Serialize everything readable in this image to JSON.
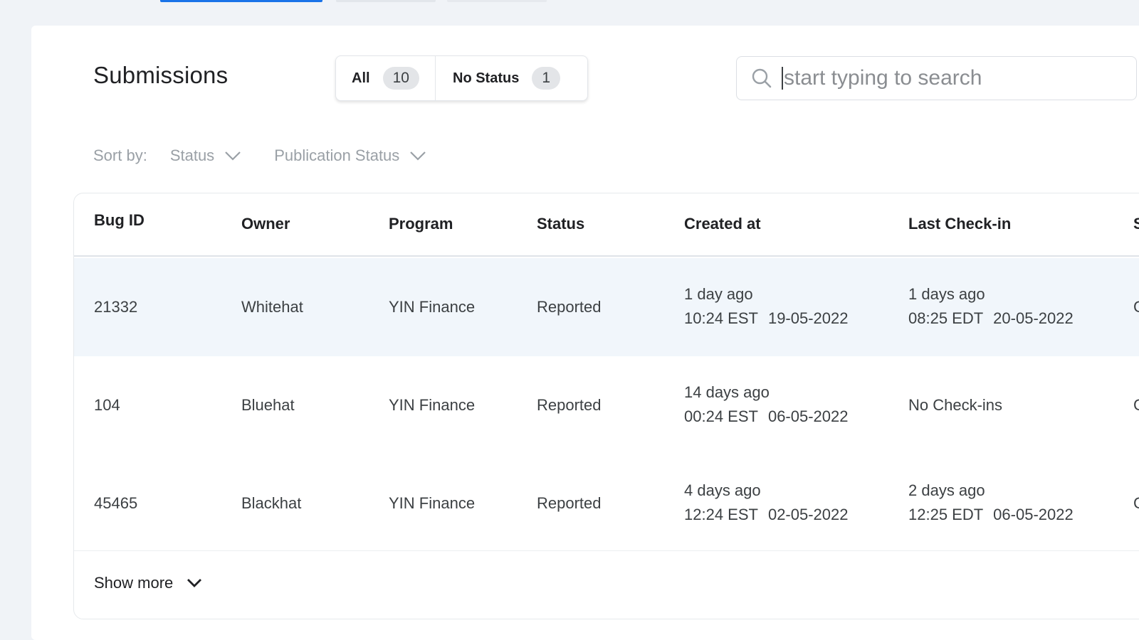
{
  "page": {
    "title": "Submissions"
  },
  "filters": {
    "all_label": "All",
    "all_count": "10",
    "no_status_label": "No Status",
    "no_status_count": "1"
  },
  "search": {
    "placeholder": "start typing to search"
  },
  "sort": {
    "label": "Sort by:",
    "options": [
      "Status",
      "Publication Status"
    ]
  },
  "table": {
    "columns": [
      "Bug ID",
      "Owner",
      "Program",
      "Status",
      "Created at",
      "Last Check-in",
      "S"
    ],
    "rows": [
      {
        "bug_id": "21332",
        "owner": "Whitehat",
        "program": "YIN Finance",
        "status": "Reported",
        "created_rel": "1 day ago",
        "created_time": "10:24 EST",
        "created_date": "19-05-2022",
        "checkin_rel": "1 days ago",
        "checkin_time": "08:25 EDT",
        "checkin_date": "20-05-2022",
        "extra": "C"
      },
      {
        "bug_id": "104",
        "owner": "Bluehat",
        "program": "YIN Finance",
        "status": "Reported",
        "created_rel": "14 days ago",
        "created_time": "00:24 EST",
        "created_date": "06-05-2022",
        "checkin_text": "No Check-ins",
        "extra": "C"
      },
      {
        "bug_id": "45465",
        "owner": "Blackhat",
        "program": "YIN Finance",
        "status": "Reported",
        "created_rel": "4 days ago",
        "created_time": "12:24 EST",
        "created_date": "02-05-2022",
        "checkin_rel": "2 days ago",
        "checkin_time": "12:25 EDT",
        "checkin_date": "06-05-2022",
        "extra": "C"
      }
    ],
    "show_more_label": "Show more"
  },
  "colors": {
    "accent": "#1a73e8",
    "page_bg": "#f0f3f7",
    "highlight_row": "#f1f6fb"
  },
  "icons": {
    "search": "search-icon",
    "dropdown": "chevron-down-icon"
  }
}
